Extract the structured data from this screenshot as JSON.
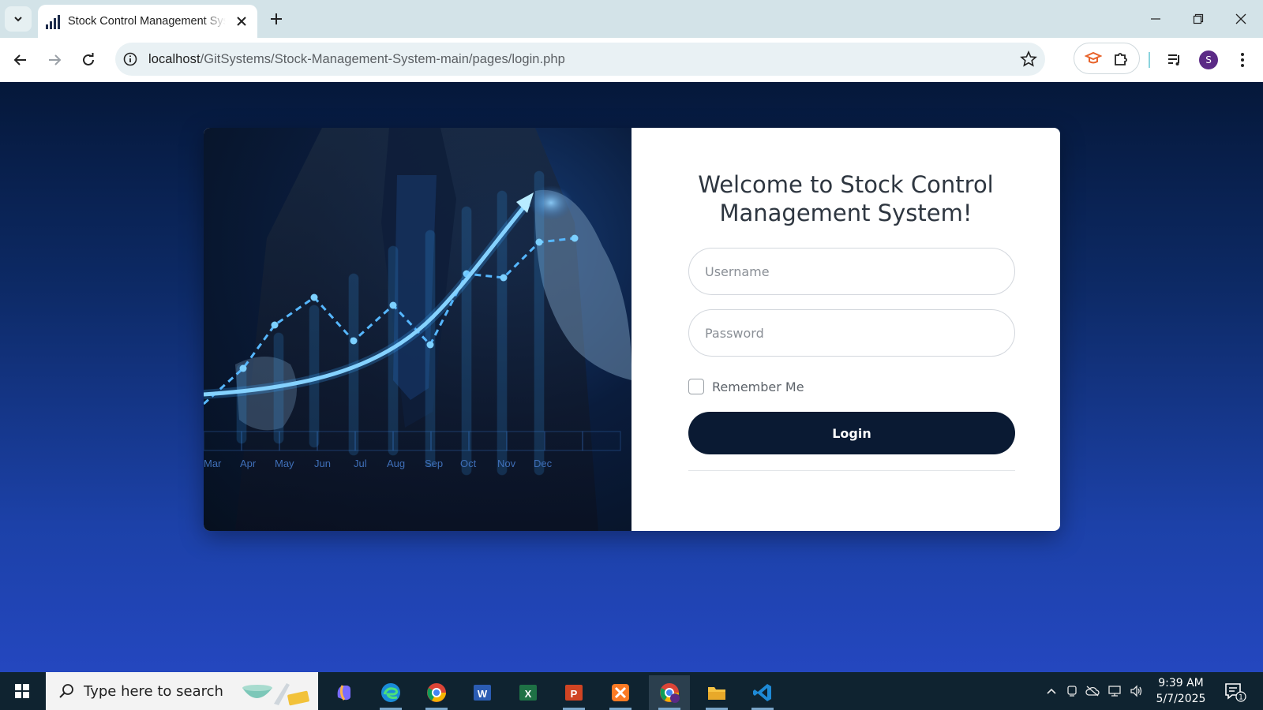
{
  "browser": {
    "tab_title": "Stock Control Management System",
    "url_host": "localhost",
    "url_path": "/GitSystems/Stock-Management-System-main/pages/login.php",
    "profile_initial": "S"
  },
  "hero": {
    "month_labels": [
      "Mar",
      "Apr",
      "May",
      "Jun",
      "Jul",
      "Aug",
      "Sep",
      "Oct",
      "Nov",
      "Dec"
    ]
  },
  "login": {
    "welcome_title": "Welcome to Stock Control Management System!",
    "username_placeholder": "Username",
    "password_placeholder": "Password",
    "remember_label": "Remember Me",
    "login_label": "Login"
  },
  "taskbar": {
    "search_placeholder": "Type here to search",
    "time": "9:39 AM",
    "date": "5/7/2025",
    "notification_count": "1",
    "apps": [
      "copilot",
      "edge",
      "chrome",
      "word",
      "excel",
      "powerpoint",
      "xampp",
      "chrome-profile",
      "file-explorer",
      "vscode"
    ]
  },
  "colors": {
    "page_top": "#05183a",
    "page_bottom": "#2447bf",
    "login_button": "#0a1a33",
    "chart_glow": "#3aa8ff"
  }
}
